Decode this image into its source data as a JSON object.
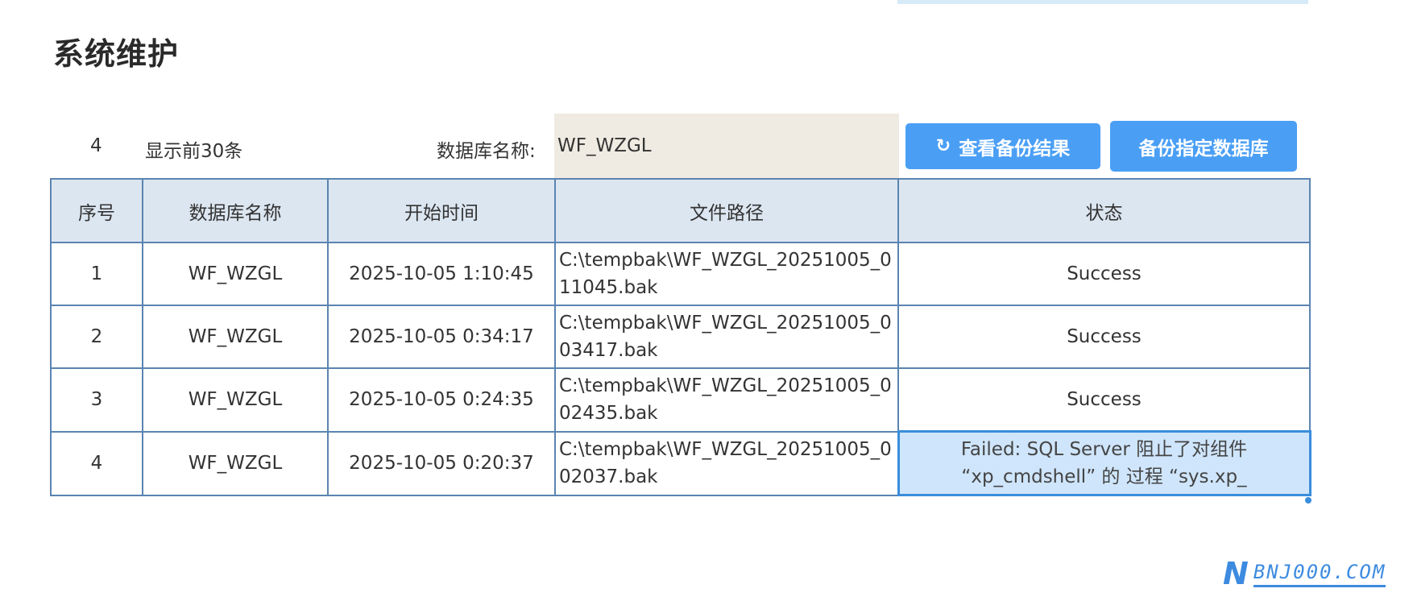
{
  "page": {
    "title": "系统维护"
  },
  "toolbar": {
    "count": "4",
    "top_label": "显示前30条",
    "db_name_label": "数据库名称:",
    "db_name_value": "WF_WZGL",
    "view_button_icon": "refresh-icon",
    "view_button_label": "查看备份结果",
    "backup_button_label": "备份指定数据库"
  },
  "table": {
    "headers": [
      "序号",
      "数据库名称",
      "开始时间",
      "文件路径",
      "状态"
    ],
    "rows": [
      {
        "index": "1",
        "db": "WF_WZGL",
        "start": "2025-10-05 1:10:45",
        "path": "C:\\tempbak\\WF_WZGL_20251005_011045.bak",
        "status": "Success"
      },
      {
        "index": "2",
        "db": "WF_WZGL",
        "start": "2025-10-05 0:34:17",
        "path": "C:\\tempbak\\WF_WZGL_20251005_003417.bak",
        "status": "Success"
      },
      {
        "index": "3",
        "db": "WF_WZGL",
        "start": "2025-10-05 0:24:35",
        "path": "C:\\tempbak\\WF_WZGL_20251005_002435.bak",
        "status": "Success"
      },
      {
        "index": "4",
        "db": "WF_WZGL",
        "start": "2025-10-05 0:20:37",
        "path": "C:\\tempbak\\WF_WZGL_20251005_002037.bak",
        "status": "Failed: SQL Server 阻止了对组件 “xp_cmdshell” 的 过程 “sys.xp_"
      }
    ]
  },
  "watermark": {
    "logo": "N",
    "text": "BNJ000.COM"
  },
  "colors": {
    "accent": "#4a9ff5",
    "table_border": "#5b84b1",
    "header_bg": "#dce6f1",
    "selected_bg": "#cfe5fb",
    "input_bg": "#efebe2"
  }
}
